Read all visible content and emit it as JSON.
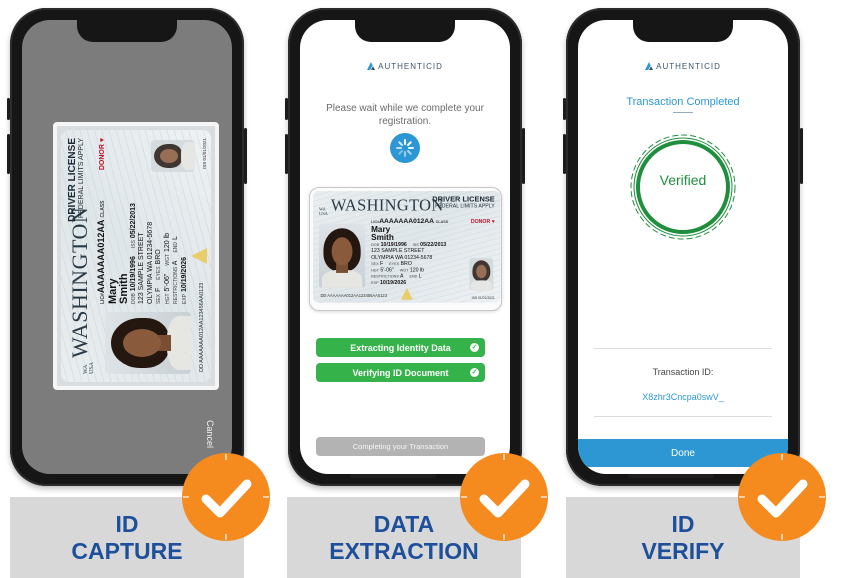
{
  "phone1": {
    "cancel_label": "Cancel"
  },
  "brand": {
    "name": "AUTHENTICID"
  },
  "phone2": {
    "wait_text": "Please wait while we complete your registration.",
    "step1": "Extracting Identity Data",
    "step2": "Verifying ID Document",
    "complete_button": "Completing your Transaction"
  },
  "phone3": {
    "title": "Transaction Completed",
    "status": "Verified",
    "tx_label": "Transaction ID:",
    "tx_value": "X8zhr3Cncpa0swV_",
    "done_button": "Done"
  },
  "id_card": {
    "state_prefix_top": "WA",
    "state_prefix_bottom": "USA",
    "state": "WASHINGTON",
    "doc_type": "DRIVER LICENSE",
    "doc_sub": "FEDERAL LIMITS APPLY",
    "lic_label": "LIC#",
    "lic_number": "AAAAAAA012AA",
    "class_label": "CLASS",
    "donor": "DONOR ♥",
    "first_name": "Mary",
    "last_name": "Smith",
    "dob_label": "DOB",
    "dob": "10/19/1996",
    "iss_label": "ISS",
    "iss": "05/22/2013",
    "address1": "123 SAMPLE STREET",
    "address2": "OLYMPIA WA 01234-5678",
    "sex_label": "SEX",
    "sex": "F",
    "eyes_label": "EYES",
    "eyes": "BRO",
    "hgt_label": "HGT",
    "hgt": "5'-06\"",
    "wgt_label": "WGT",
    "wgt": "120 lb",
    "restrictions_label": "RESTRICTIONS",
    "restrictions": "A",
    "end_label": "END",
    "end": "L",
    "exp_label": "EXP",
    "exp": "10/19/2026",
    "dd_label": "DD",
    "dd": "AAAAAAA012AA123456AA0123",
    "iss_short": "ISS 01/01/2021"
  },
  "labels": {
    "step1_line1": "ID",
    "step1_line2": "CAPTURE",
    "step2_line1": "DATA",
    "step2_line2": "EXTRACTION",
    "step3_line1": "ID",
    "step3_line2": "VERIFY"
  },
  "colors": {
    "accent_blue": "#2c97d3",
    "label_blue": "#1d4f9a",
    "success_green": "#35b34a",
    "badge_orange": "#f58a1f"
  }
}
